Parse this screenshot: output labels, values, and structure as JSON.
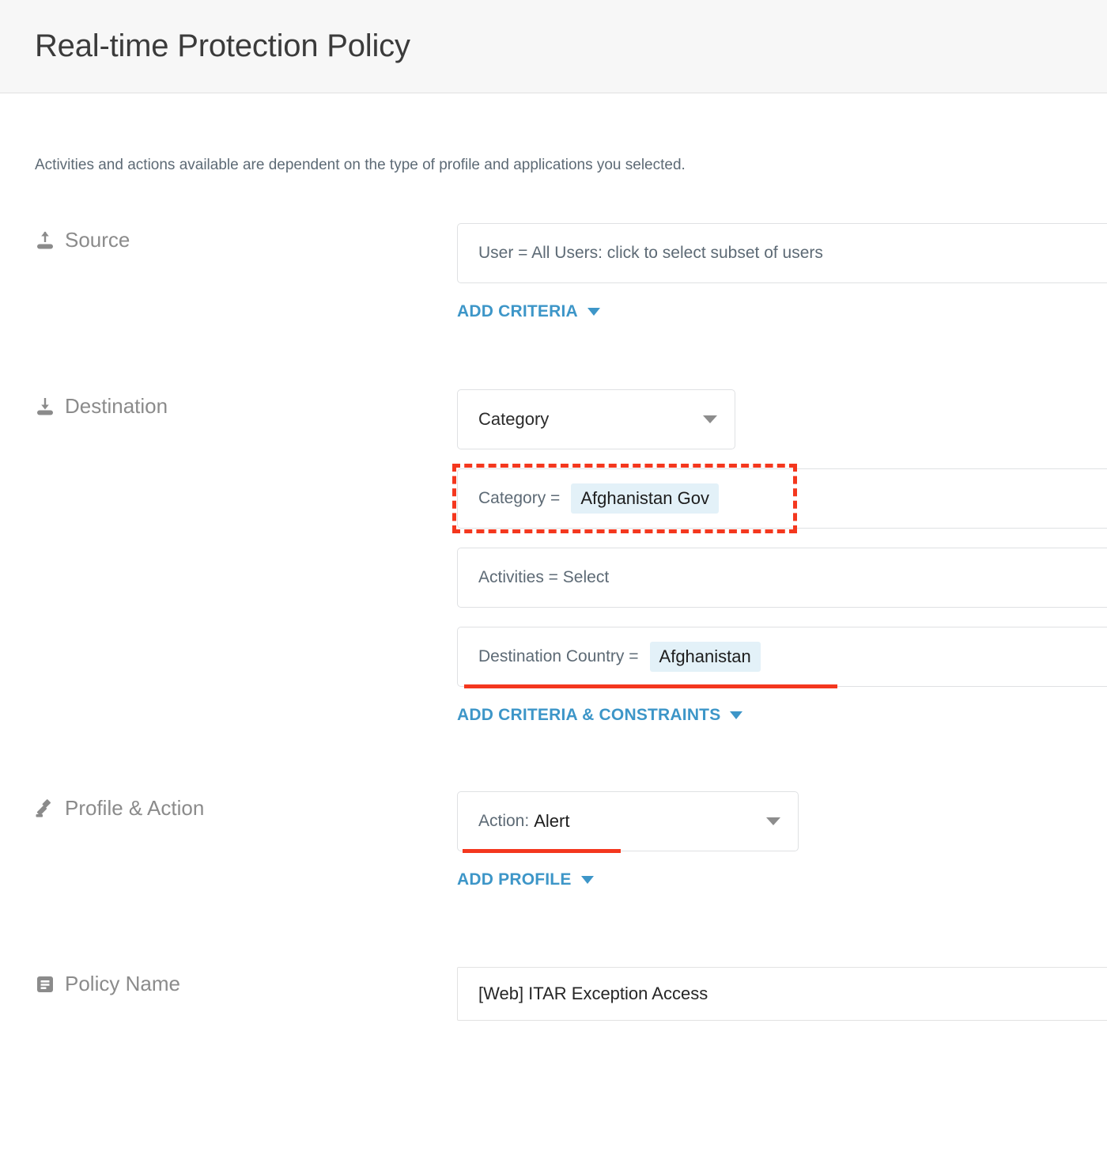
{
  "header": {
    "title": "Real-time Protection Policy"
  },
  "intro": {
    "text": "Activities and actions available are dependent on the type of profile and applications you selected."
  },
  "colors": {
    "link_blue": "#3d96c8",
    "annotation_red": "#f4371e",
    "tag_background": "#e3f1f8",
    "header_background": "#f7f7f7"
  },
  "sections": {
    "source": {
      "label": "Source",
      "icon": "upload-icon",
      "criteria": {
        "text": "User = All Users: click to select subset of users"
      },
      "add_link": {
        "label": "ADD CRITERIA"
      }
    },
    "destination": {
      "label": "Destination",
      "icon": "download-icon",
      "type_select": {
        "value": "Category"
      },
      "category_criteria": {
        "label": "Category =",
        "value": "Afghanistan Gov",
        "highlighted": true
      },
      "activities_criteria": {
        "text": "Activities = Select"
      },
      "country_criteria": {
        "label": "Destination Country =",
        "value": "Afghanistan",
        "underlined": true
      },
      "add_link": {
        "label": "ADD CRITERIA & CONSTRAINTS"
      }
    },
    "profile_action": {
      "label": "Profile & Action",
      "icon": "gavel-icon",
      "action_select": {
        "label": "Action:",
        "value": "Alert",
        "underlined": true
      },
      "add_link": {
        "label": "ADD PROFILE"
      }
    },
    "policy_name": {
      "label": "Policy Name",
      "icon": "note-lines-icon",
      "input": {
        "value": "[Web] ITAR Exception Access",
        "placeholder": "Policy Name"
      }
    }
  }
}
